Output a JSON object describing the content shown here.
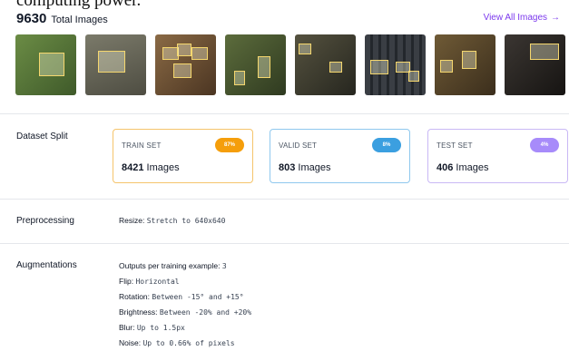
{
  "header": {
    "cutoff_text": "computing power.",
    "total_count": "9630",
    "total_label": "Total Images",
    "view_all_label": "View All Images",
    "view_all_arrow": "→"
  },
  "thumbnails": [
    {
      "name": "bird-image-1",
      "bg": "#5a7a3a"
    },
    {
      "name": "bird-image-2",
      "bg": "#6b6a5c"
    },
    {
      "name": "bird-image-3",
      "bg": "#6f5438"
    },
    {
      "name": "bird-image-4",
      "bg": "#4a5a34"
    },
    {
      "name": "bird-image-5",
      "bg": "#3f3f34"
    },
    {
      "name": "bird-image-6",
      "bg": "#2e3238"
    },
    {
      "name": "bird-image-7",
      "bg": "#5b4a2f"
    },
    {
      "name": "bird-image-8",
      "bg": "#2a2826"
    }
  ],
  "split": {
    "label": "Dataset Split",
    "train": {
      "title": "TRAIN SET",
      "badge": "87%",
      "count": "8421",
      "unit": "Images",
      "color": "#f59e0b"
    },
    "valid": {
      "title": "VALID SET",
      "badge": "8%",
      "count": "803",
      "unit": "Images",
      "color": "#3b9fe0"
    },
    "test": {
      "title": "TEST SET",
      "badge": "4%",
      "count": "406",
      "unit": "Images",
      "color": "#a78bfa"
    }
  },
  "preprocessing": {
    "label": "Preprocessing",
    "resize_key": "Resize:",
    "resize_value": "Stretch to 640x640"
  },
  "augmentations": {
    "label": "Augmentations",
    "outputs_key": "Outputs per training example:",
    "outputs_value": "3",
    "flip_key": "Flip:",
    "flip_value": "Horizontal",
    "rotation_key": "Rotation:",
    "rotation_value": "Between -15° and +15°",
    "brightness_key": "Brightness:",
    "brightness_value": "Between -20% and +20%",
    "blur_key": "Blur:",
    "blur_value": "Up to 1.5px",
    "noise_key": "Noise:",
    "noise_value": "Up to 0.66% of pixels"
  }
}
